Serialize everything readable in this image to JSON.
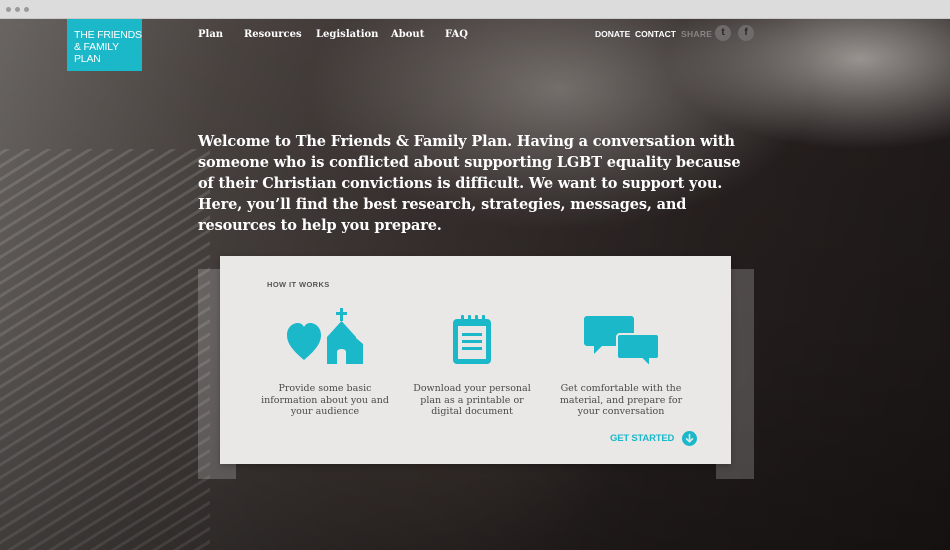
{
  "browser": {
    "dots": [
      "dot",
      "dot",
      "dot"
    ]
  },
  "brand": {
    "logo_text": "THE FRIENDS & FAMILY PLAN",
    "accent": "#1ab8c9"
  },
  "nav": {
    "items": [
      "Plan",
      "Resources",
      "Legislation",
      "About",
      "FAQ"
    ]
  },
  "utility": {
    "donate": "DONATE",
    "contact": "CONTACT",
    "share": "SHARE",
    "twitter_glyph": "t",
    "facebook_glyph": "f"
  },
  "intro": {
    "text": "Welcome to The Friends & Family Plan. Having a conversation with someone who is conflicted about supporting LGBT equality because of their Christian convictions is difficult. We want to support you. Here, you’ll find the best research, strategies, messages, and resources to help you prepare."
  },
  "how_it_works": {
    "heading": "HOW IT WORKS",
    "steps": [
      {
        "icon": "heart-church-icon",
        "text": "Provide some basic information about you and your audience"
      },
      {
        "icon": "notepad-icon",
        "text": "Download your personal plan as a printable or digital document"
      },
      {
        "icon": "chat-bubbles-icon",
        "text": "Get comfortable with the material, and prepare for your conversation"
      }
    ],
    "cta": "GET STARTED",
    "cta_icon": "arrow-down-circle-icon"
  }
}
